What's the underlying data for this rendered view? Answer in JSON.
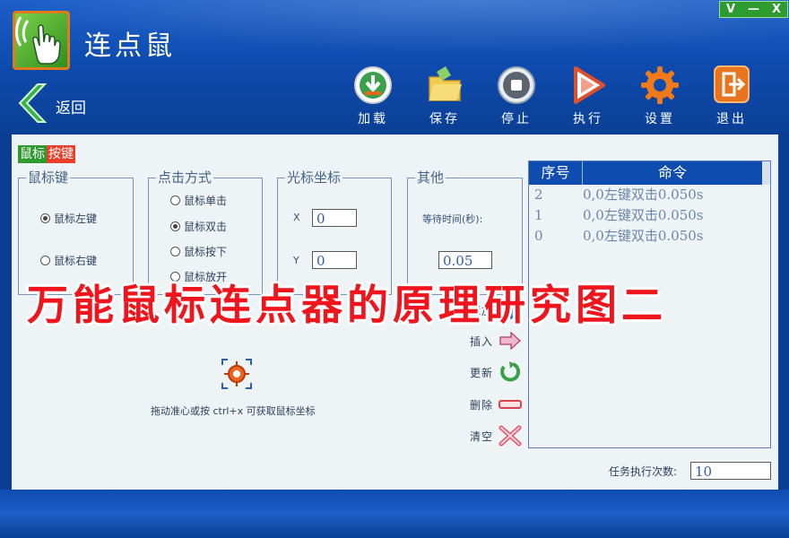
{
  "app": {
    "title": "连点鼠",
    "window_controls": [
      "V",
      "—",
      "X"
    ]
  },
  "nav": {
    "back_label": "返回"
  },
  "toolbar": [
    {
      "id": "load",
      "label": "加载",
      "icon": "download-icon"
    },
    {
      "id": "save",
      "label": "保存",
      "icon": "folder-save-icon"
    },
    {
      "id": "stop",
      "label": "停止",
      "icon": "stop-icon"
    },
    {
      "id": "run",
      "label": "执行",
      "icon": "play-icon"
    },
    {
      "id": "settings",
      "label": "设置",
      "icon": "gear-icon"
    },
    {
      "id": "exit",
      "label": "退出",
      "icon": "exit-icon"
    }
  ],
  "tag": {
    "part1": "鼠标",
    "part2": "按键"
  },
  "mouse_key": {
    "title": "鼠标键",
    "options": [
      {
        "label": "鼠标左键",
        "selected": true
      },
      {
        "label": "鼠标右键",
        "selected": false
      }
    ]
  },
  "click_mode": {
    "title": "点击方式",
    "options": [
      {
        "label": "鼠标单击",
        "selected": false
      },
      {
        "label": "鼠标双击",
        "selected": true
      },
      {
        "label": "鼠标按下",
        "selected": false
      },
      {
        "label": "鼠标放开",
        "selected": false
      }
    ]
  },
  "cursor_coords": {
    "title": "光标坐标",
    "x_label": "X",
    "y_label": "Y",
    "x_value": "0",
    "y_value": "0"
  },
  "other": {
    "title": "其他",
    "wait_label": "等待时间(秒):",
    "wait_value": "0.05"
  },
  "crosshair": {
    "hint": "拖动准心或按 ctrl+x 可获取鼠标坐标"
  },
  "commands": [
    {
      "label": "添加",
      "icon": "arrow-right-icon"
    },
    {
      "label": "插入",
      "icon": "arrow-right-pink-icon"
    },
    {
      "label": "更新",
      "icon": "refresh-icon"
    },
    {
      "label": "删除",
      "icon": "minus-icon"
    },
    {
      "label": "清空",
      "icon": "clear-x-icon"
    }
  ],
  "table": {
    "headers": [
      "序号",
      "命令"
    ],
    "rows": [
      {
        "index": "2",
        "command": "0,0左键双击0.050s"
      },
      {
        "index": "1",
        "command": "0,0左键双击0.050s"
      },
      {
        "index": "0",
        "command": "0,0左键双击0.050s"
      }
    ]
  },
  "loop": {
    "label": "任务执行次数:",
    "value": "10"
  },
  "watermark": "万能鼠标连点器的原理研究图二",
  "colors": {
    "header_blue": "#0f4cb0",
    "accent_green": "#2e9b2e",
    "accent_red": "#e8402a",
    "panel_bg": "#eef4f5",
    "watermark_red": "#f0141c"
  }
}
